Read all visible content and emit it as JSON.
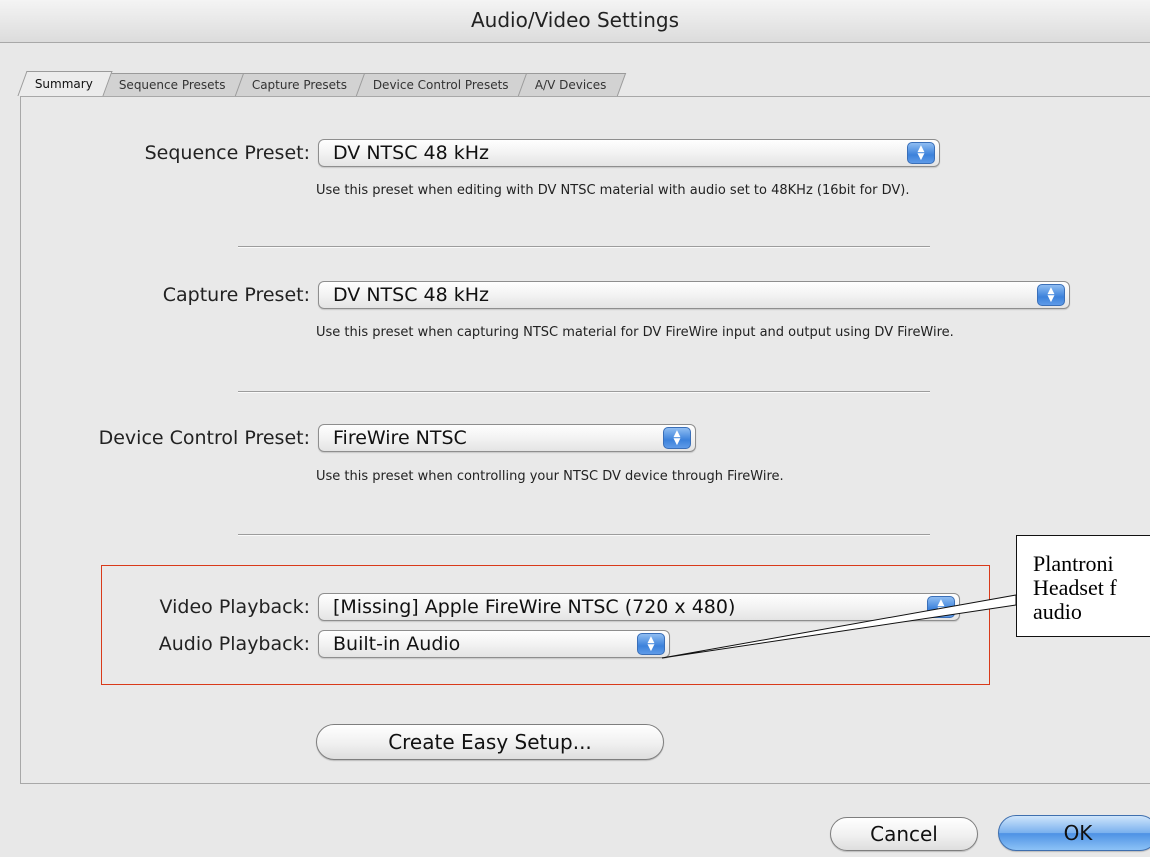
{
  "window": {
    "title": "Audio/Video Settings"
  },
  "tabs": [
    {
      "label": "Summary",
      "active": true
    },
    {
      "label": "Sequence Presets",
      "active": false
    },
    {
      "label": "Capture Presets",
      "active": false
    },
    {
      "label": "Device Control Presets",
      "active": false
    },
    {
      "label": "A/V Devices",
      "active": false
    }
  ],
  "sequence_preset": {
    "label": "Sequence Preset:",
    "value": "DV NTSC 48 kHz",
    "help": "Use this preset when editing with DV NTSC material with audio set to 48KHz (16bit for DV)."
  },
  "capture_preset": {
    "label": "Capture Preset:",
    "value": "DV NTSC 48 kHz",
    "help": "Use this preset when capturing NTSC material for DV FireWire input and output using DV FireWire."
  },
  "device_control_preset": {
    "label": "Device Control Preset:",
    "value": "FireWire NTSC",
    "help": "Use this preset when controlling your NTSC DV device through FireWire."
  },
  "video_playback": {
    "label": "Video Playback:",
    "value": "[Missing] Apple FireWire NTSC (720 x 480)"
  },
  "audio_playback": {
    "label": "Audio Playback:",
    "value": "Built-in Audio"
  },
  "buttons": {
    "create_easy_setup": "Create Easy Setup...",
    "cancel": "Cancel",
    "ok": "OK"
  },
  "callout": {
    "lines": [
      "Plantroni",
      "Headset f",
      "audio"
    ]
  },
  "colors": {
    "highlight_box": "#d93a1a",
    "popup_arrow_blue": "#3c82db",
    "default_button_blue": "#79b0ee"
  }
}
